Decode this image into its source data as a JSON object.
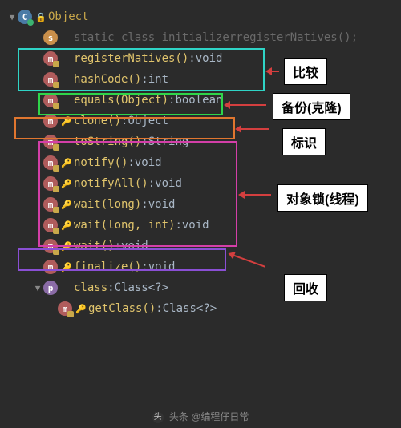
{
  "root": {
    "name": "Object"
  },
  "members": [
    {
      "icon": "static",
      "key": "",
      "name": "static class initializer",
      "sig": "",
      "ret": "registerNatives();",
      "dim": true
    },
    {
      "icon": "method-lock",
      "key": "",
      "name": "registerNatives()",
      "sig": ": ",
      "ret": "void"
    },
    {
      "icon": "method-lock",
      "key": "",
      "name": "hashCode()",
      "sig": ": ",
      "ret": "int"
    },
    {
      "icon": "method-lock",
      "key": "",
      "name": "equals(Object)",
      "sig": ": ",
      "ret": "boolean"
    },
    {
      "icon": "method",
      "key": "🔑",
      "name": "clone()",
      "sig": ": ",
      "ret": "Object"
    },
    {
      "icon": "method-lock",
      "key": "",
      "name": "toString()",
      "sig": ": ",
      "ret": "String"
    },
    {
      "icon": "method-lock",
      "key": "🔑",
      "name": "notify()",
      "sig": ": ",
      "ret": "void"
    },
    {
      "icon": "method-lock",
      "key": "🔑",
      "name": "notifyAll()",
      "sig": ": ",
      "ret": "void"
    },
    {
      "icon": "method-lock",
      "key": "🔑",
      "name": "wait(long)",
      "sig": ": ",
      "ret": "void"
    },
    {
      "icon": "method-lock",
      "key": "🔑",
      "name": "wait(long, int)",
      "sig": ": ",
      "ret": "void"
    },
    {
      "icon": "method-lock",
      "key": "🔑",
      "name": "wait()",
      "sig": ": ",
      "ret": "void"
    },
    {
      "icon": "method",
      "key": "🔑",
      "name": "finalize()",
      "sig": ": ",
      "ret": "void"
    },
    {
      "icon": "prop",
      "key": "",
      "name": "class",
      "sig": ": ",
      "ret": "Class<?>",
      "expandable": true
    },
    {
      "icon": "method-lock",
      "key": "🔑",
      "name": "getClass()",
      "sig": ": ",
      "ret": "Class<?>",
      "indent": 2,
      "dim": false
    }
  ],
  "labels": {
    "compare": "比较",
    "backup": "备份(克隆)",
    "identify": "标识",
    "lock": "对象锁(线程)",
    "gc": "回收"
  },
  "footer": "头条 @编程仔日常"
}
